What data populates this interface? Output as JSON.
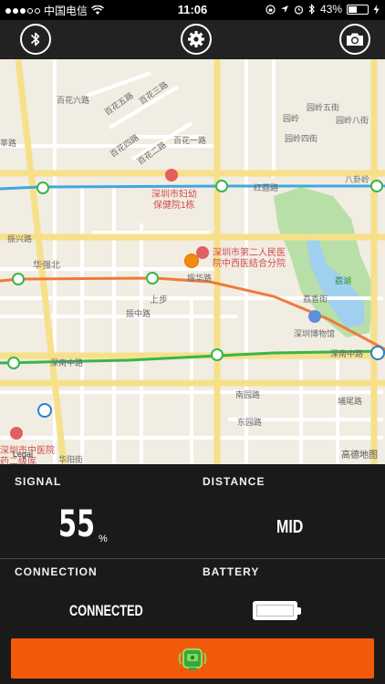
{
  "status_bar": {
    "carrier": "中国电信",
    "time": "11:06",
    "battery_text": "43%",
    "battery_level": 0.43,
    "icons": [
      "signal-dots",
      "wifi-icon",
      "rotation-lock-icon",
      "location-icon",
      "alarm-icon",
      "bluetooth-icon",
      "battery-icon",
      "charging-icon"
    ]
  },
  "toolbar": {
    "left_icon": "bluetooth-icon",
    "center_icon": "gear-icon",
    "right_icon": "camera-icon"
  },
  "map": {
    "labels": {
      "baihua6": "百花六路",
      "baihua5": "百花五路",
      "baihua3": "百花三路",
      "baihua4": "百花四路",
      "baihua2": "百花二路",
      "baihua1": "百花一路",
      "xinzhou": "莘路",
      "hospital1_a": "深圳市妇幼",
      "hospital1_b": "保健院1栋",
      "hongli": "红荔路",
      "zhenxing": "振兴路",
      "huaqiangbei": "华强北",
      "hospital2_a": "深圳市第二人民医",
      "hospital2_b": "院中西医结合分院",
      "zhenhua": "振华路",
      "shangbu": "上步",
      "zhenzhong": "振中路",
      "lizhi": "荔湖",
      "lizhi_road": "荔香街",
      "museum": "深圳博物馆",
      "shennan_left": "深南中路",
      "shennan_right": "深南中路",
      "nanyuan": "南园路",
      "dongyuan": "东园路",
      "buwei": "埔尾路",
      "huayang": "华阳街",
      "tcm_a": "深圳市中医院",
      "tcm_b": "药二级库",
      "yuanling5": "园岭五街",
      "yuanling8": "园岭八街",
      "yuanling4": "园岭四街",
      "bagua": "八卦岭",
      "yuanling": "园岭",
      "legal": "Legal",
      "provider": "高德地图"
    },
    "pin_color": "#f28a10"
  },
  "dashboard": {
    "signal_label": "SIGNAL",
    "signal_value": "55",
    "signal_unit": "%",
    "distance_label": "DISTANCE",
    "distance_value": "MID",
    "connection_label": "CONNECTION",
    "connection_value": "CONNECTED",
    "battery_label": "BATTERY",
    "battery_level": 1.0,
    "action_icon": "device-alarm-icon",
    "accent_color": "#f05a0a"
  }
}
